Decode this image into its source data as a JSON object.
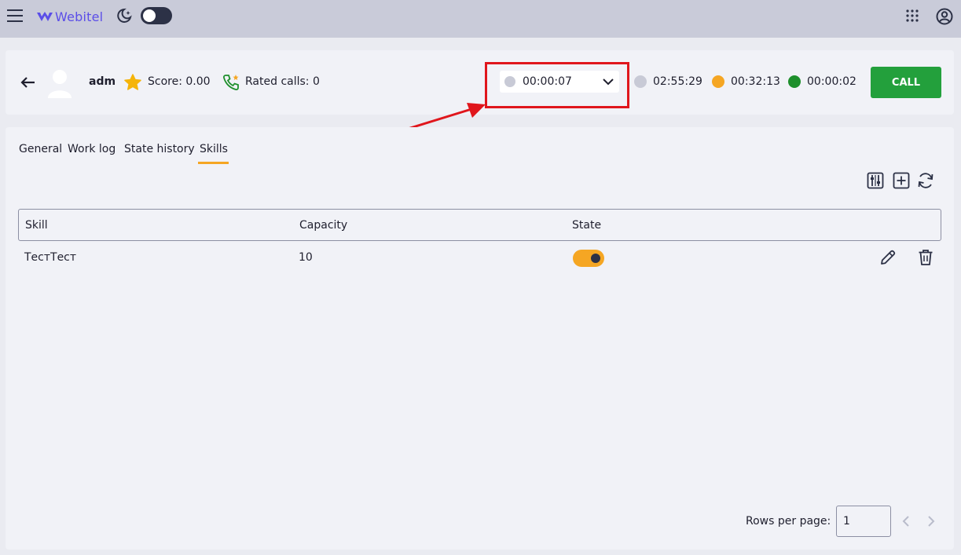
{
  "topbar": {
    "logo_text": "Webitel",
    "menu_icon": "hamburger-icon",
    "theme_icon": "moon-icon",
    "apps_icon": "apps-grid-icon",
    "account_icon": "account-icon"
  },
  "agent": {
    "name": "adm",
    "score": "Score: 0.00",
    "rated_calls": "Rated calls: 0",
    "status": {
      "time": "00:00:07",
      "color": "#c8cad6"
    },
    "timers": [
      {
        "time": "02:55:29",
        "color": "#c8cad6"
      },
      {
        "time": "00:32:13",
        "color": "#f5a623"
      },
      {
        "time": "00:00:02",
        "color": "#1e8f2c"
      }
    ],
    "call_label": "CALL"
  },
  "tabs": [
    "General",
    "Work log",
    "State history",
    "Skills"
  ],
  "active_tab": "Skills",
  "table": {
    "columns": [
      "Skill",
      "Capacity",
      "State"
    ],
    "rows": [
      {
        "skill": "ТестТест",
        "capacity": "10",
        "state": true
      }
    ]
  },
  "pagination": {
    "rows_label": "Rows per page:",
    "rows_value": "1"
  },
  "colors": {
    "accent": "#f5a623",
    "call": "#23a03c",
    "highlight": "#e0161c",
    "logo": "#5b4ee8"
  }
}
